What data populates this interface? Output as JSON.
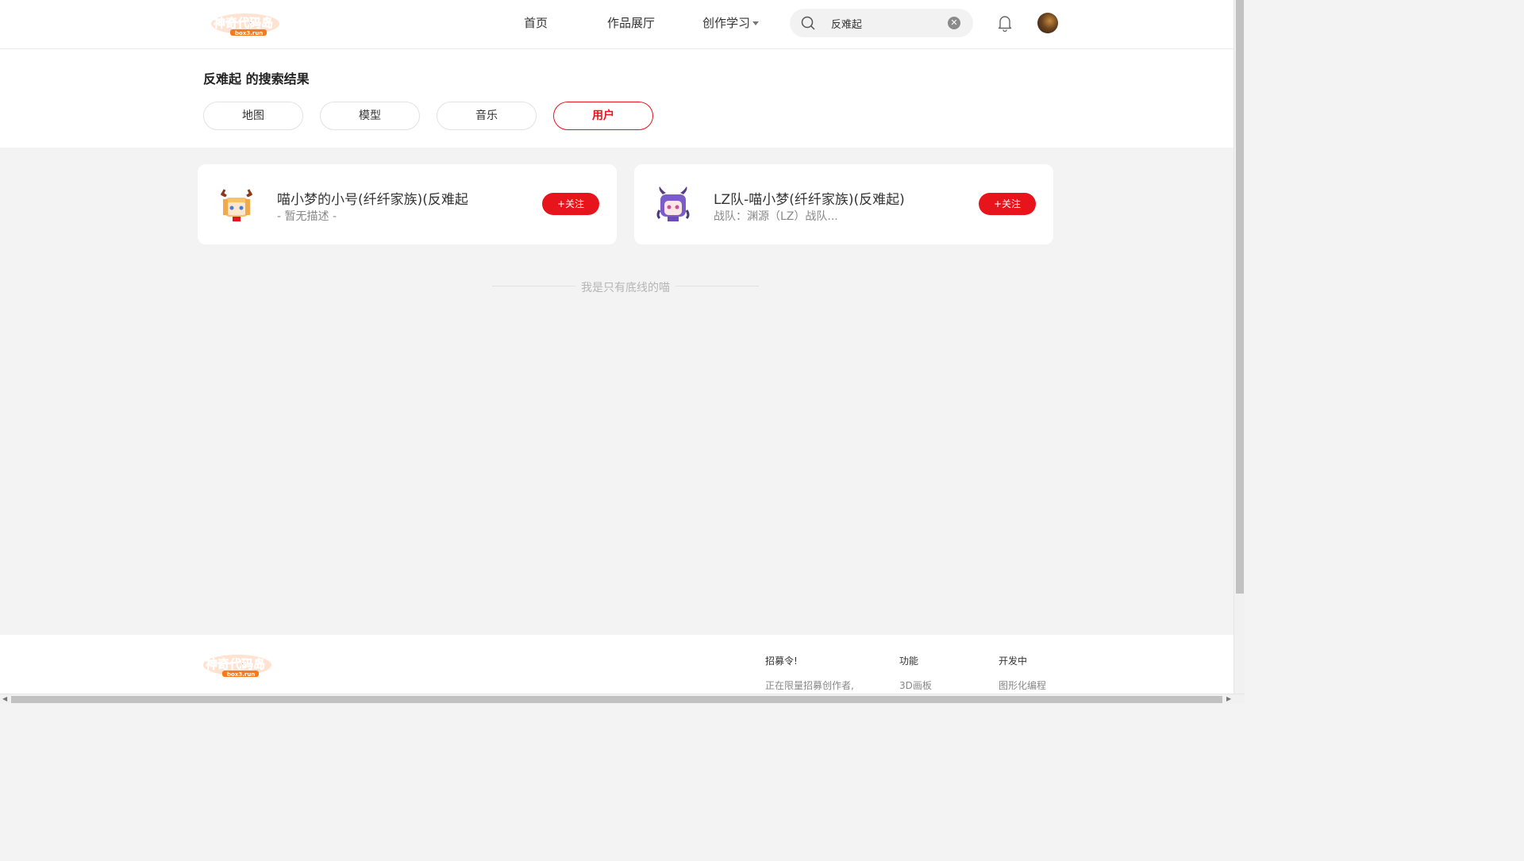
{
  "brand": {
    "name": "神奇代码岛",
    "domain": "box3.run",
    "color": "#e8141b"
  },
  "nav": {
    "home": "首页",
    "gallery": "作品展厅",
    "learn": "创作学习"
  },
  "search": {
    "value": "反难起"
  },
  "results": {
    "title": "反难起 的搜索结果",
    "tabs": [
      {
        "label": "地图"
      },
      {
        "label": "模型"
      },
      {
        "label": "音乐"
      },
      {
        "label": "用户",
        "active": true
      }
    ]
  },
  "users": [
    {
      "name": "喵小梦的小号(纤纤家族)(反难起",
      "desc": "- 暂无描述 -",
      "follow": "+关注"
    },
    {
      "name": "LZ队-喵小梦(纤纤家族)(反难起)",
      "desc": "战队：渊源（LZ）战队...",
      "follow": "+关注"
    }
  ],
  "end_text": "我是只有底线的喵",
  "footer": {
    "cols": [
      {
        "heading": "招募令!",
        "item": "正在限量招募创作者,"
      },
      {
        "heading": "功能",
        "item": "3D画板"
      },
      {
        "heading": "开发中",
        "item": "图形化编程"
      }
    ]
  },
  "icons": {
    "search": "search-icon",
    "clear": "clear-icon",
    "bell": "bell-icon",
    "dropdown": "chevron-down-icon"
  }
}
